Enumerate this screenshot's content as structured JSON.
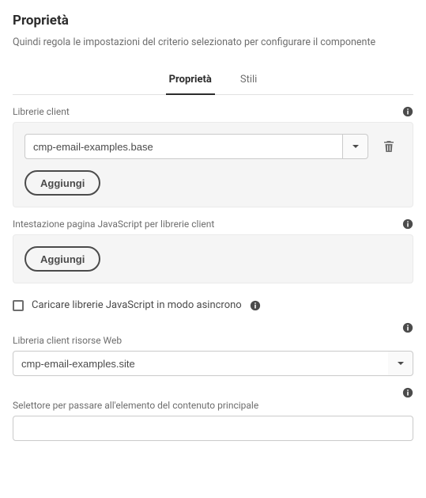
{
  "header": {
    "title": "Proprietà",
    "subtitle": "Quindi regola le impostazioni del criterio selezionato per configurare il componente"
  },
  "tabs": {
    "0": {
      "label": "Proprietà"
    },
    "1": {
      "label": "Stili"
    }
  },
  "fields": {
    "clientLibs": {
      "label": "Librerie client",
      "items": {
        "0": {
          "value": "cmp-email-examples.base"
        }
      },
      "addLabel": "Aggiungi"
    },
    "jsHead": {
      "label": "Intestazione pagina JavaScript per librerie client",
      "addLabel": "Aggiungi"
    },
    "asyncJs": {
      "label": "Caricare librerie JavaScript in modo asincrono"
    },
    "webResources": {
      "label": "Libreria client risorse Web",
      "value": "cmp-email-examples.site"
    },
    "mainSelector": {
      "label": "Selettore per passare all'elemento del contenuto principale",
      "value": ""
    }
  }
}
